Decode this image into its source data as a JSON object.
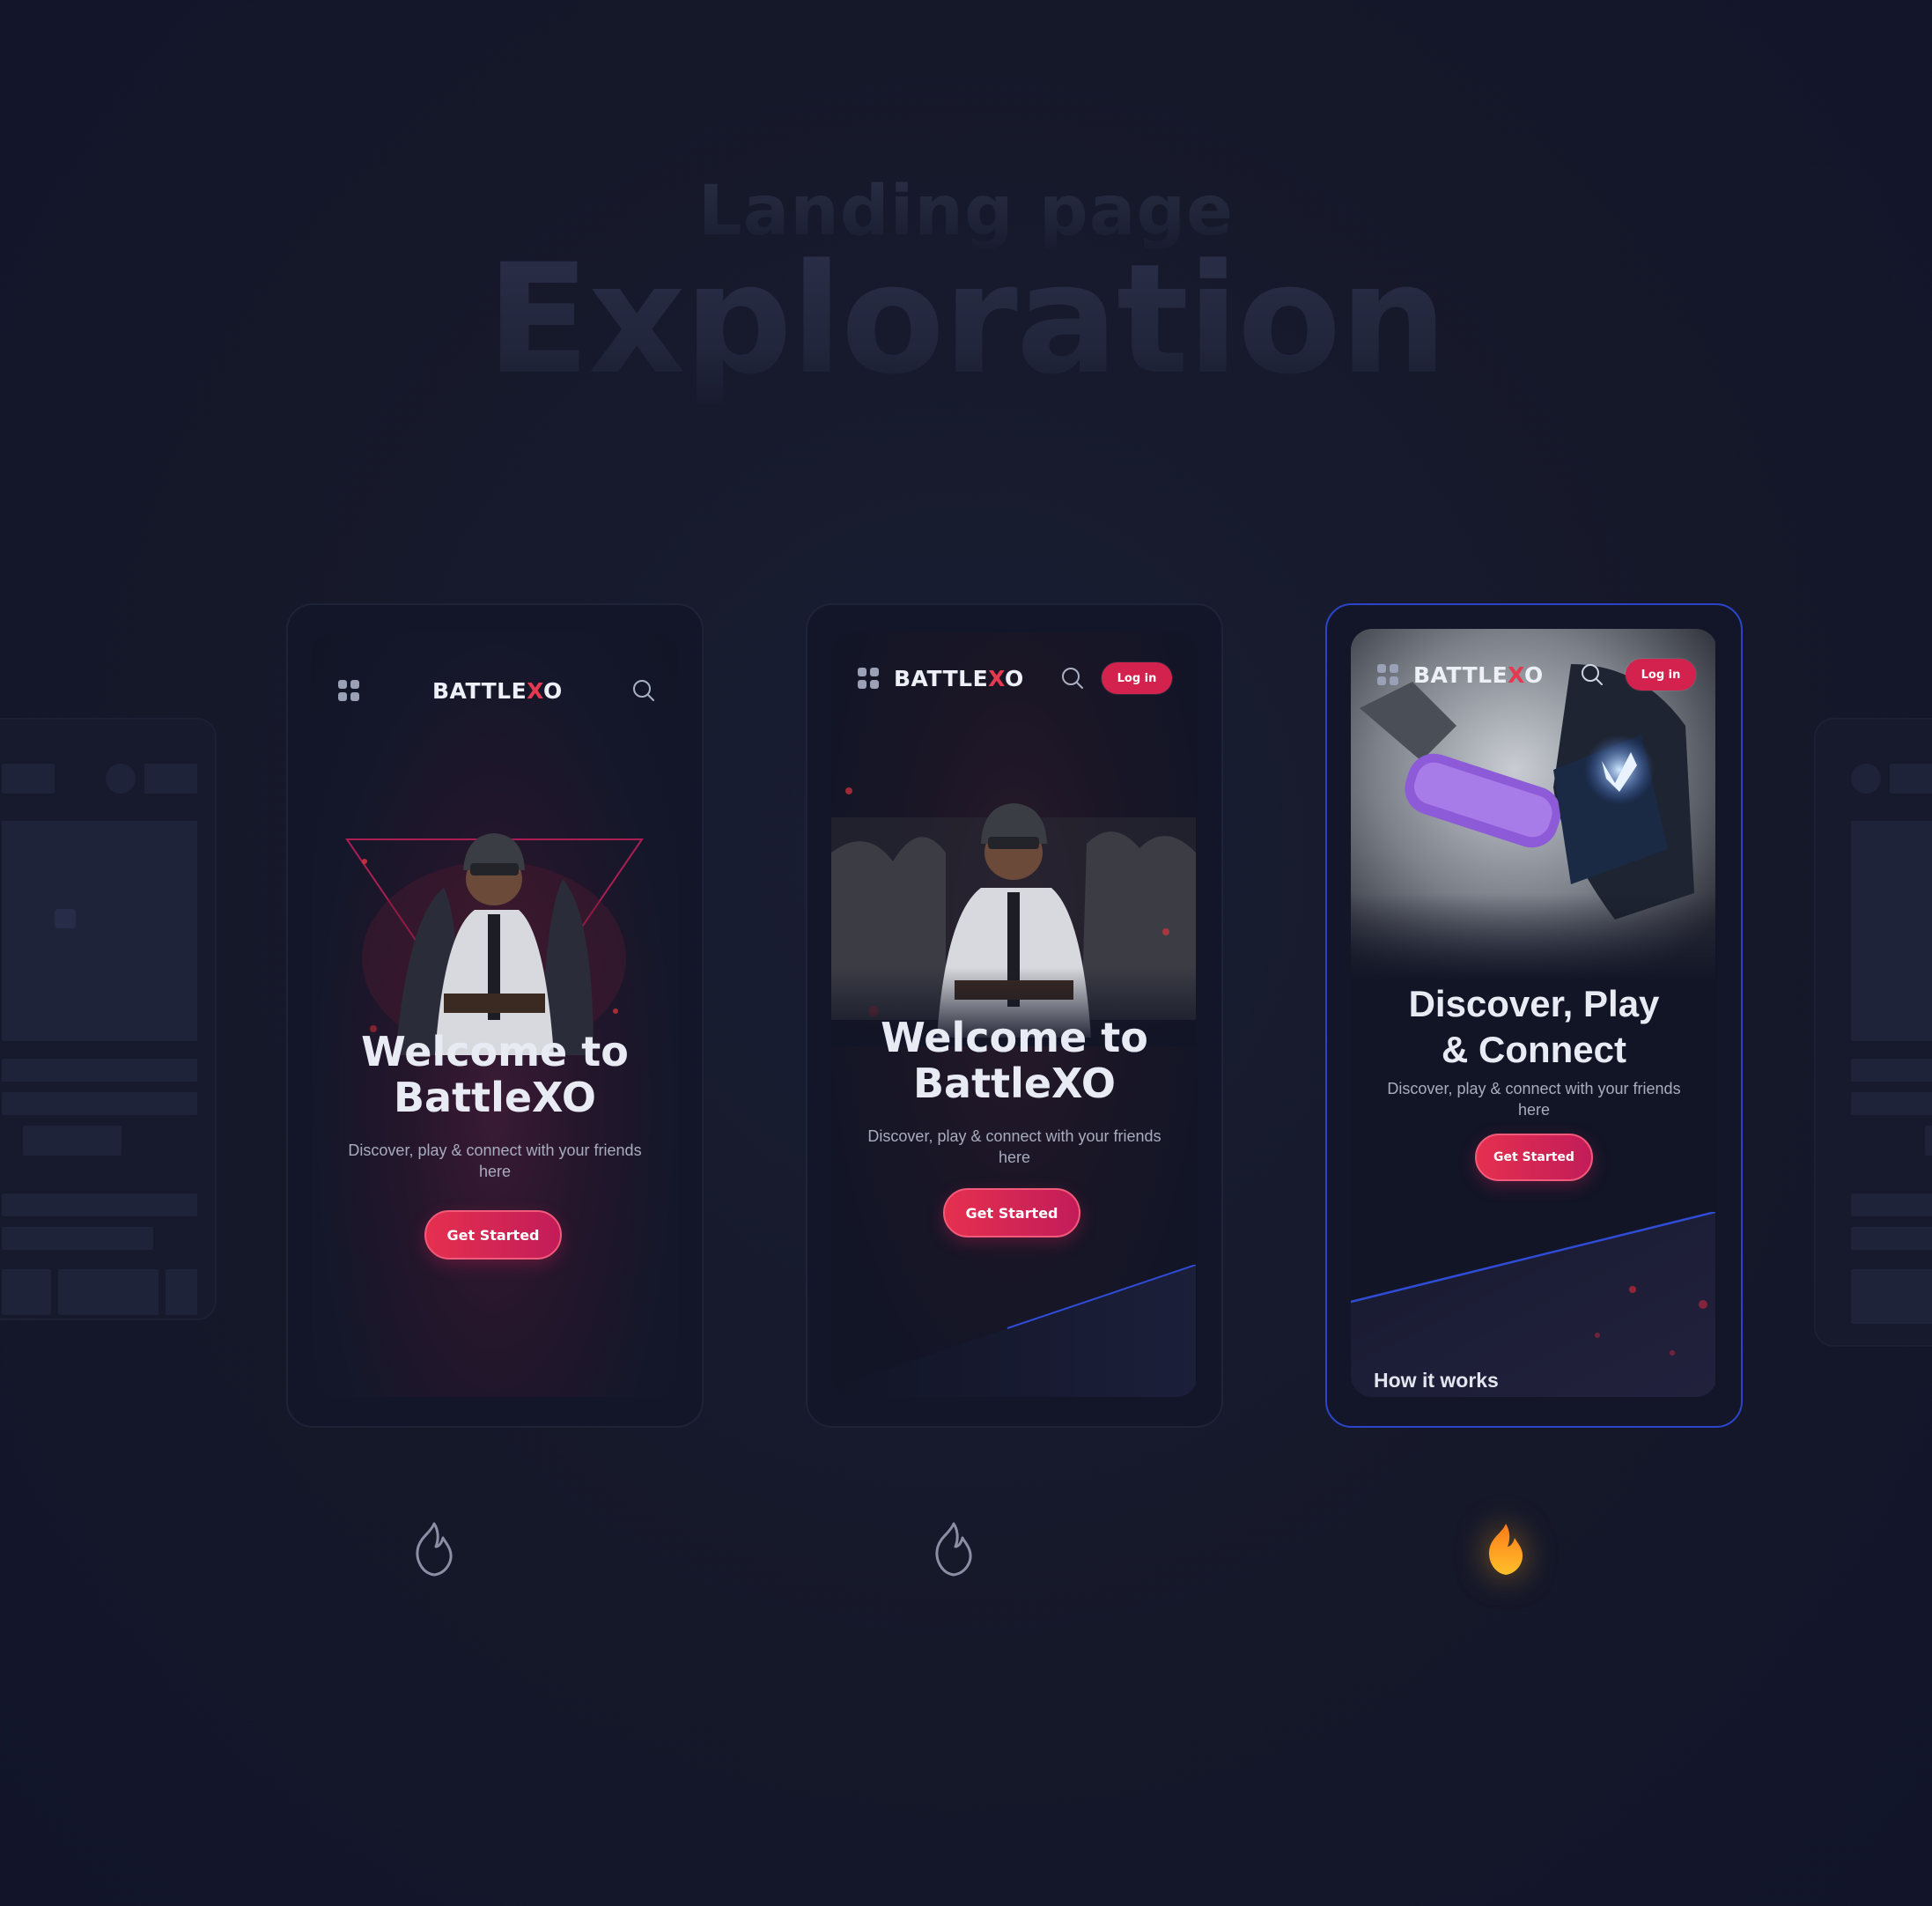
{
  "page": {
    "subtitle": "Landing page",
    "title": "Exploration"
  },
  "brand": {
    "logo_prefix": "BATTLE",
    "logo_mark": "X",
    "logo_suffix": "O",
    "accent_red": "#d3224d",
    "active_border": "#2a45c9",
    "flame_active": "#f59e1b"
  },
  "variants": [
    {
      "menu_icon": "grid-menu-icon",
      "search_icon": "search-icon",
      "hero_line1": "Welcome to",
      "hero_line2": "BattleXO",
      "hero_sub": "Discover, play & connect with your friends here",
      "cta": "Get Started",
      "vote_icon": "flame-outline-icon"
    },
    {
      "menu_icon": "grid-menu-icon",
      "search_icon": "search-icon",
      "login": "Log in",
      "hero_line1": "Welcome to",
      "hero_line2": "BattleXO",
      "hero_sub": "Discover, play & connect with your friends here",
      "cta": "Get Started",
      "vote_icon": "flame-outline-icon"
    },
    {
      "menu_icon": "grid-menu-icon",
      "search_icon": "search-icon",
      "login": "Log in",
      "hero_line1": "Discover, Play",
      "hero_line2": "& Connect",
      "hero_sub": "Discover, play & connect with your friends here",
      "cta": "Get Started",
      "section": "How it works",
      "vote_icon": "flame-filled-icon"
    }
  ]
}
